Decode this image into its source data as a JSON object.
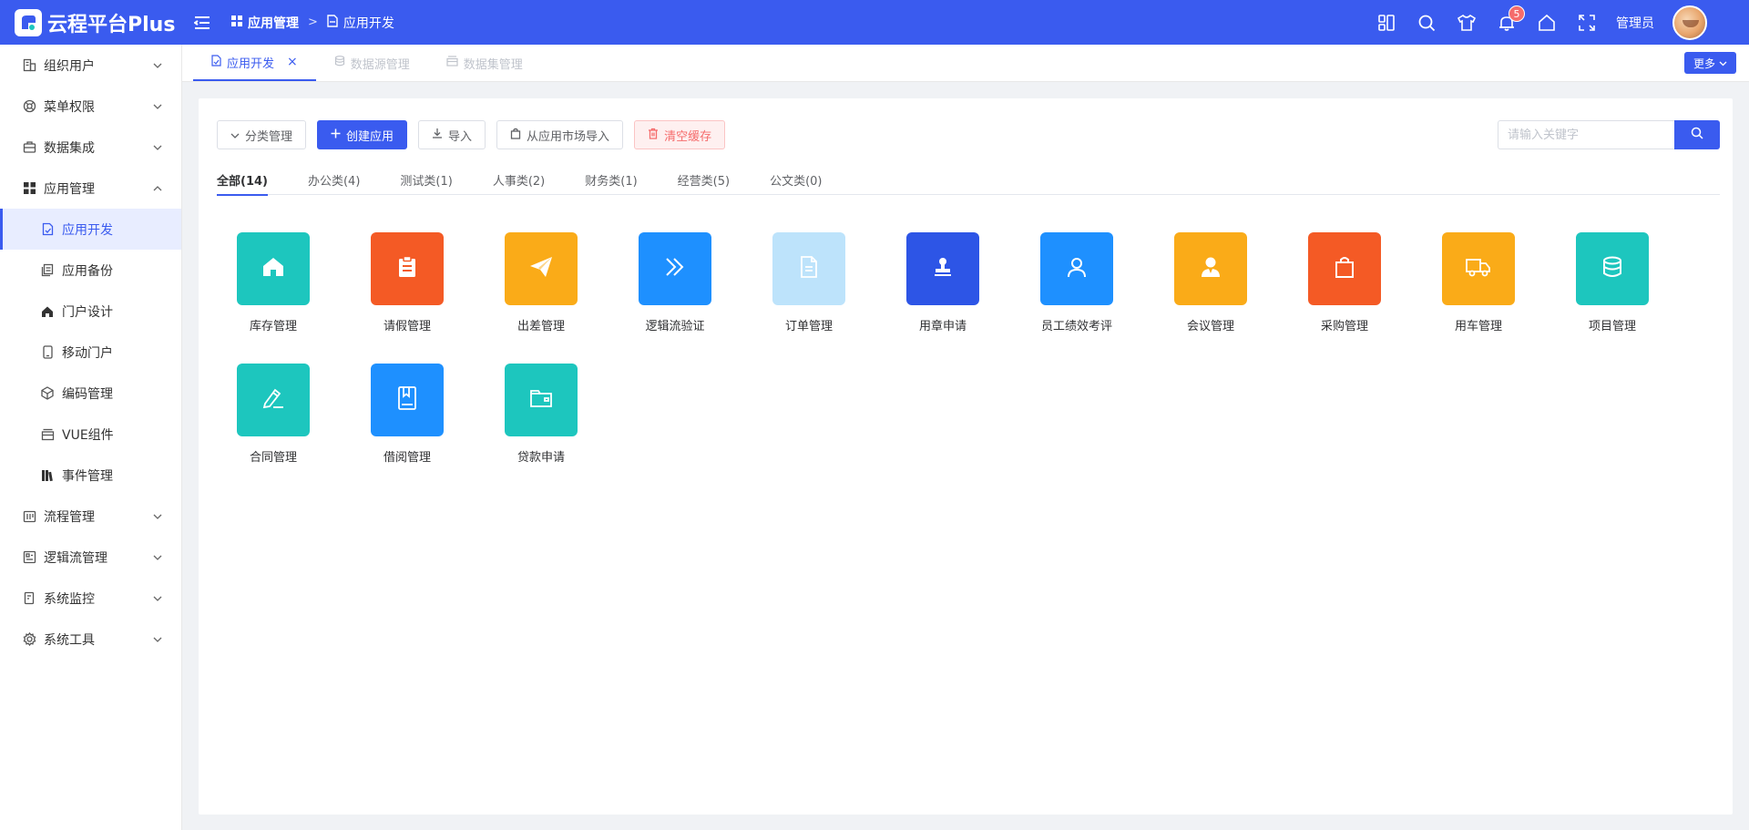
{
  "brand": {
    "name": "云程平台Plus"
  },
  "breadcrumb": [
    {
      "label": "应用管理",
      "icon": "grid-icon"
    },
    {
      "label": "应用开发",
      "icon": "file-icon"
    }
  ],
  "header": {
    "user_name": "管理员",
    "notification_count": "5",
    "icons": [
      "layout-icon",
      "search-icon",
      "shirt-icon",
      "bell-icon",
      "home-icon",
      "fullscreen-icon"
    ]
  },
  "sidebar": {
    "items": [
      {
        "label": "组织用户",
        "icon": "building-icon"
      },
      {
        "label": "菜单权限",
        "icon": "lifebuoy-icon"
      },
      {
        "label": "数据集成",
        "icon": "briefcase-icon"
      },
      {
        "label": "应用管理",
        "icon": "grid-icon",
        "expanded": true
      },
      {
        "label": "应用开发",
        "icon": "file-icon",
        "active": true
      },
      {
        "label": "应用备份",
        "icon": "copy-icon"
      },
      {
        "label": "门户设计",
        "icon": "home-icon"
      },
      {
        "label": "移动门户",
        "icon": "mobile-icon"
      },
      {
        "label": "编码管理",
        "icon": "cube-icon"
      },
      {
        "label": "VUE组件",
        "icon": "box-icon"
      },
      {
        "label": "事件管理",
        "icon": "books-icon"
      },
      {
        "label": "流程管理",
        "icon": "flow-icon"
      },
      {
        "label": "逻辑流管理",
        "icon": "logic-icon"
      },
      {
        "label": "系统监控",
        "icon": "monitor-icon"
      },
      {
        "label": "系统工具",
        "icon": "gear-icon"
      }
    ]
  },
  "tabs": [
    {
      "label": "应用开发",
      "active": true,
      "close": "×"
    },
    {
      "label": "数据源管理",
      "active": false
    },
    {
      "label": "数据集管理",
      "active": false
    }
  ],
  "more_label": "更多",
  "toolbar": {
    "category": "分类管理",
    "create": "创建应用",
    "import": "导入",
    "market_import": "从应用市场导入",
    "clear_cache": "清空缓存"
  },
  "search": {
    "placeholder": "请输入关键字"
  },
  "categories": [
    {
      "label": "全部(14)",
      "active": true
    },
    {
      "label": "办公类(4)"
    },
    {
      "label": "测试类(1)"
    },
    {
      "label": "人事类(2)"
    },
    {
      "label": "财务类(1)"
    },
    {
      "label": "经营类(5)"
    },
    {
      "label": "公文类(0)"
    }
  ],
  "apps": [
    {
      "name": "库存管理",
      "icon": "home-icon",
      "color": "#1dc6be"
    },
    {
      "name": "请假管理",
      "icon": "clipboard-icon",
      "color": "#f45a25"
    },
    {
      "name": "出差管理",
      "icon": "paper-plane-icon",
      "color": "#faab18"
    },
    {
      "name": "逻辑流验证",
      "icon": "double-chevron-icon",
      "color": "#1e90ff"
    },
    {
      "name": "订单管理",
      "icon": "document-icon",
      "color": "#bde3fb"
    },
    {
      "name": "用章申请",
      "icon": "stamp-icon",
      "color": "#2d55e6"
    },
    {
      "name": "员工绩效考评",
      "icon": "user-icon",
      "color": "#1e90ff"
    },
    {
      "name": "会议管理",
      "icon": "person-icon",
      "color": "#faab18"
    },
    {
      "name": "采购管理",
      "icon": "shopping-bag-icon",
      "color": "#f45a25"
    },
    {
      "name": "用车管理",
      "icon": "truck-icon",
      "color": "#faab18"
    },
    {
      "name": "项目管理",
      "icon": "database-icon",
      "color": "#1dc6be"
    },
    {
      "name": "合同管理",
      "icon": "pen-icon",
      "color": "#1dc6be"
    },
    {
      "name": "借阅管理",
      "icon": "book-icon",
      "color": "#1e90ff"
    },
    {
      "name": "贷款申请",
      "icon": "wallet-icon",
      "color": "#1dc6be"
    }
  ]
}
